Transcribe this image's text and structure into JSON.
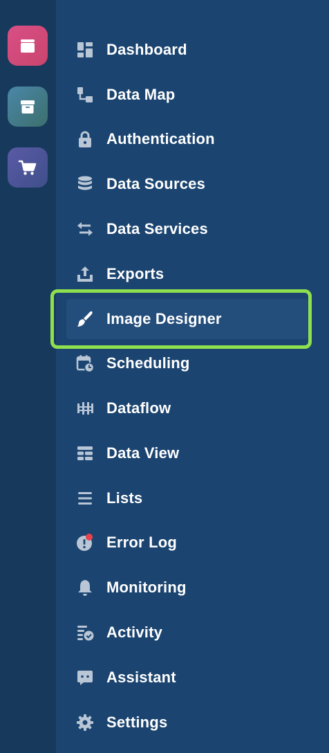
{
  "apps": [
    {
      "name": "files",
      "icon": "folder-icon",
      "color": "#d94f86"
    },
    {
      "name": "box",
      "icon": "archive-box-icon",
      "color": "#4a87a8"
    },
    {
      "name": "cart",
      "icon": "shopping-cart-icon",
      "color": "#5a5aa6"
    }
  ],
  "nav": {
    "items": [
      {
        "label": "Dashboard",
        "icon": "dashboard-icon"
      },
      {
        "label": "Data Map",
        "icon": "data-map-icon"
      },
      {
        "label": "Authentication",
        "icon": "lock-icon"
      },
      {
        "label": "Data Sources",
        "icon": "database-icon"
      },
      {
        "label": "Data Services",
        "icon": "exchange-arrows-icon"
      },
      {
        "label": "Exports",
        "icon": "upload-icon"
      },
      {
        "label": "Image Designer",
        "icon": "paint-brush-icon",
        "active": true
      },
      {
        "label": "Scheduling",
        "icon": "calendar-clock-icon"
      },
      {
        "label": "Dataflow",
        "icon": "dataflow-icon"
      },
      {
        "label": "Data View",
        "icon": "data-view-icon"
      },
      {
        "label": "Lists",
        "icon": "list-icon"
      },
      {
        "label": "Error Log",
        "icon": "error-log-icon"
      },
      {
        "label": "Monitoring",
        "icon": "bell-icon"
      },
      {
        "label": "Activity",
        "icon": "activity-icon"
      },
      {
        "label": "Assistant",
        "icon": "chat-icon"
      },
      {
        "label": "Settings",
        "icon": "gear-icon"
      }
    ]
  },
  "colors": {
    "rail_bg": "#173a5c",
    "nav_bg": "#1b4470",
    "active_bg": "#234d7a",
    "highlight": "#8ee04f",
    "icon": "#b9c6d6",
    "error_dot": "#e8434f"
  }
}
